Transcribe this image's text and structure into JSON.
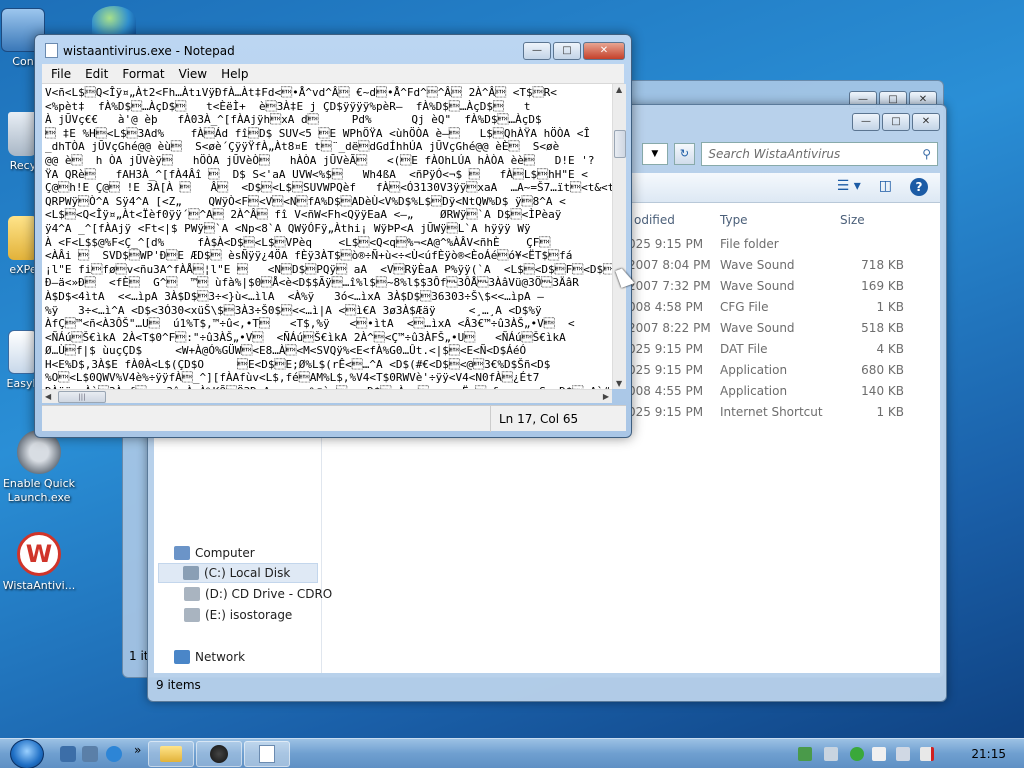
{
  "desktop": {
    "icons": [
      {
        "label": "Con",
        "name": "desktop-icon-computer"
      },
      {
        "label": "Recy",
        "name": "desktop-icon-recycle-bin"
      },
      {
        "label": "eXPe",
        "name": "desktop-icon-expe"
      },
      {
        "label": "Easyb",
        "name": "desktop-icon-easyb"
      },
      {
        "label": "Enable Quick Launch.exe",
        "name": "desktop-icon-enable-quick-launch"
      },
      {
        "label": "WistaAntivi...",
        "name": "desktop-icon-wistaantivirus"
      }
    ]
  },
  "explorer": {
    "search_placeholder": "Search WistaAntivirus",
    "columns": {
      "modified": "odified",
      "type": "Type",
      "size": "Size"
    },
    "files": [
      {
        "date": "025 9:15 PM",
        "type": "File folder",
        "size": ""
      },
      {
        "date": "2007 8:04 PM",
        "type": "Wave Sound",
        "size": "718 KB"
      },
      {
        "date": "2007 7:32 PM",
        "type": "Wave Sound",
        "size": "169 KB"
      },
      {
        "date": "008 4:58 PM",
        "type": "CFG File",
        "size": "1 KB"
      },
      {
        "date": "2007 8:22 PM",
        "type": "Wave Sound",
        "size": "518 KB"
      },
      {
        "date": "025 9:15 PM",
        "type": "DAT File",
        "size": "4 KB"
      },
      {
        "date": "025 9:15 PM",
        "type": "Application",
        "size": "680 KB"
      },
      {
        "date": "008 4:55 PM",
        "type": "Application",
        "size": "140 KB"
      },
      {
        "date": "025 9:15 PM",
        "type": "Internet Shortcut",
        "size": "1 KB"
      }
    ],
    "nav": {
      "computer": "Computer",
      "local_disk": "(C:) Local Disk",
      "cd_drive": "(D:) CD Drive - CDRO",
      "isostorage": "(E:) isostorage",
      "network": "Network"
    },
    "status": "9 items",
    "back_window_status": "1 it"
  },
  "notepad": {
    "title": "wistaantivirus.exe - Notepad",
    "menu": {
      "file": "File",
      "edit": "Edit",
      "format": "Format",
      "view": "View",
      "help": "Help"
    },
    "content": "V<ñ<L$\u0002Q<Îÿ¤„Àt2<Fh…ÀtıVÿÐfÀ…Àt‡Fd<\u0003•Å^vd^Â\u0002 €~d\u0003•Å^Fd^\u0002^Â\u0002 2À^Â\u0002 <T$\u0002R<\n<%pèt‡  fÀ%D$\u0003…ÀçD$\u0003   t<ÈëÌ+  è\u00033À‡E j ÇD$ÿÿÿÿ%pèR‒  fÀ%D$\u0003…ÀçD$\u0003   t\nÀ jŪVç€€   à'@ èþ   fÀ03À_^[fÀAjÿh\u0003xA d\u0003     Pd%      Qj èQ\"  fÀ%D$\u0003…ÀçD$\n\u0003 ‡E %H\u0003<L$\u00033Ad%    fÀ\u0003Ád fî\u0003D$ SUV<5 \u0003E WPhÖŸA <ùhÖÒA è‒\u0003   L$\u0003QhÀŸA hÖÒA <Î\n_dhTÒA jŪVçGhé@@ èù\u0003  S<øè´ÇÿÿŸfÀ„Àt8¤E t\u0003¨_dë\u0003dGdÍhhÚA jŪVçGhé@@ èÈ\u0003  S<øè\n@@ è\u0003  h ÒA jŪVèÿ\u0003   hÖÒA jŪVèÒ\u0003   hÀÒA jŪVèÃ\u0003   <(\u0003E fÀOhLÚA hÀÒA èè\u0003   D!E '?\nŸA QRè\u0003   fAH3À_^[fÀ4Âî \u0003  D$ S<'aA UVW<%$\u0003   Wh4ßA  <ñPÿÓ<¬$ \u0003   fÀ\u0003L$\u0003hH\"E <\nÇ@\u0003h!E Ç@\u0003 !E 3À[À \u0003   Â\u0003  <D$\u0003<L$\u0003SUVWPQèf   fÀ\u0003<Ó3130V3ÿÿ\u0003xaA  …A~=Š7…ït\u0003<t&<t\nQRPWÿ\u0003Ò^A Sÿ4^A [<Z„    QWÿÒ<F\u0003<V\u0003<N\u0003fA%D$\u0003ADèÙ<V%D$%L$\u0003Dÿ<NtQW%D$ ÿ\u00038^A <\n<L$\u0003<Q<Îÿ¤„Àt<Ïèf0ÿÿ´\u0003^A\u0003 2À^Â\u0003 fî V<ñW<Fh<QÿÿEaA <‒„    ØRWÿ\u0003`A D$\u0003<ÌPèaÿ\nÿ4^A _^[fÀAjÿ <Ft<|$ PWÿ\u0003`A <Np<8`A QWÿÓFÿ„Àthi¡ WÿÞP<A jŪWÿ\u0003L`A hÿÿÿ Wÿ\nÀ <F<L$$@%F<Ç_^[d%     fÀ$À<D$\u0003<L$\u0003VPèq    <L$\u0003<Q<q\u0003%¬<A@^%ÀÂV<ñhÈ    ÇF\u0003\n<ÀÂi \u0003  SVD$\u0003WP'Ð\u0003E ÆD$\u0003 èsÑÿÿ¿4ÖA fÈÿ3ÀT$\u0003ò®÷Ñ+ù<÷<Ù<úfÈÿò®<ÈoÁé\u0003ó¥<ËT$\u0003fá\n¡l\"E fi\u0003fø\u0003v<ñu3A^fÀÅ\u0003¦l\"E \u0003   <N\u0003D$\u0003PQÿ\u0003 aA  <V\u0003RÿÈaA P%ÿÿ(`A  <L$\u0003<D$\u0003F\u0003<D$\u0003PG\nÐ–ä<»Ð\u0003  <fÈ\u0003  G^\u0003  ™\u0003 ùfà%|$0\u0003Å<è<D$$Ãÿ\u0003…î%l$\u0003~8%l$$3Ôf\u00003ÔÅ\u00003ÀâVü@3Ö\u00003ÄâR\nÀ$D$<4ìtA  <<…ìpA 3À$D$\u00033÷<}ù<…ìlA  <À%ÿ   3ó<…ìxA 3À$D$\u000336303÷Š\\$<<…ìpA ‒\n%ÿ   3÷<…ì^A <D$<3Ó30<xüŠ\\$\u00033À3÷Š0$\u0003<<…ì|A <\u0003ì€A 3ø3À$Æäÿ     <¸…¸A <D$%ÿ\nÀfÇ\u0003™<ñ<À3ÔŠ\"…U\u0003  ú1%T$,™÷û<,•T\u0003   <T$,%ÿ   <\u0003•ìtA  <\u0003…ìxA <Â3€™÷û3ÀŠ„•V\u0003  <\n<ÑÁú\u0003Š€ìkA 2À<T$0^F\u0003:\"÷û3ÀŠ„•V\u0003  <ÑÁú\u0003Š€ìkA 2À^\u0003<Ç™÷û3ÀFŠ„•U\u0003   <ÑÁú\u0003Š€ìkA\nØ…Ù\u0003f|$ ùuçÇD$     <W+À@Ó%GÜW\u0003<E8…À\u0003<M<SVQÿ%<E<fÀ%G0…Ût.<|$\u0003<E<Ñ<D$ÁéÓ\nH<E%D$,3À$E fÀ0À<L$(ÇD$O     \u0003E<D$\u0003E;Ø%L$(rÊ<\u0003…^A <D$(#€<D$\u0003<@\u00033€%D$Šñ<D$\n%O\u0003<L$0QWV%V4è%÷ÿÿfÀ\u0003_^][fÀAfùv<L$,fé\u0003AM%L$,%V4<T$0RWVè'÷ÿÿ<V4<N0fÀ\u0003¿Ét7\nÐÀÿÿ  Àè\u00033À…f\u0003   3î<À;À%KÕ\u0003Ö3Ð<A ¸    %©è‒\u0003  <D$\u0003…À„»\u0003    <Ë…\u0003…§     <S,<D$\u0003;Aù#",
    "status_position": "Ln 17, Col 65"
  },
  "taskbar": {
    "clock": "21:15",
    "quicklaunch_more": "»"
  }
}
